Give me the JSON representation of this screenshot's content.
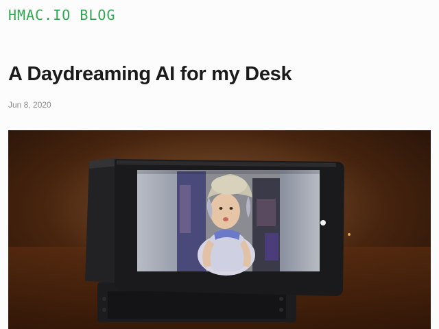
{
  "site": {
    "title": "HMAC.IO BLOG"
  },
  "post": {
    "title": "A Daydreaming AI for my Desk",
    "date": "Jun 8, 2020"
  },
  "hero_image": {
    "subject": "photo-of-desk-display-showing-child-portrait"
  },
  "colors": {
    "site_title": "#2ea84f",
    "heading": "#1b1b1b",
    "date": "#8a8a8a",
    "background": "#fcfcfc"
  }
}
